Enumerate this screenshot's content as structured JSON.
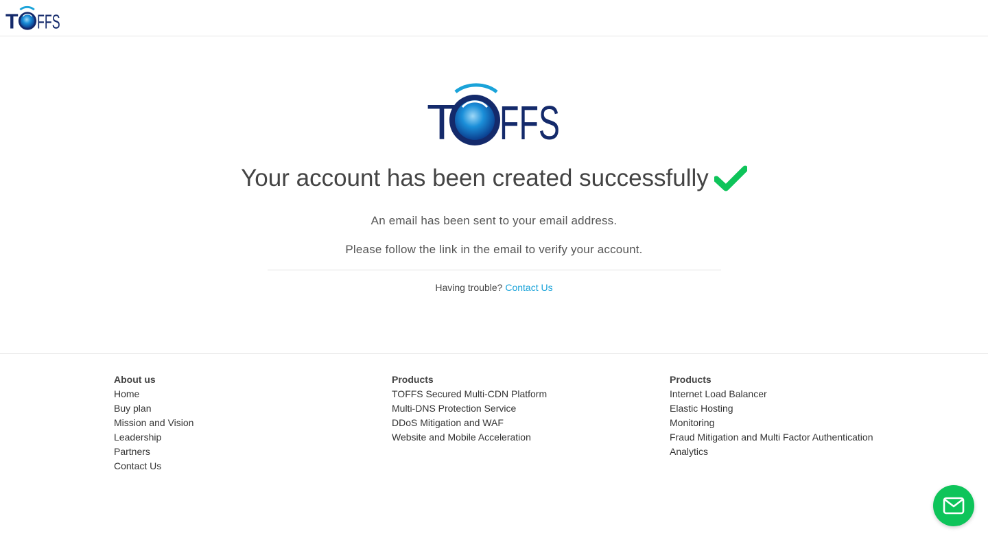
{
  "brand": {
    "logo_text": "TOFFS",
    "primary_color": "#142a6b",
    "accent_color": "#1aa3d9"
  },
  "main": {
    "title": "Your account has been created successfully",
    "message_line1": "An email has been sent to your email address.",
    "message_line2": "Please follow the link in the email to verify your account.",
    "trouble_text": "Having trouble? ",
    "contact_link": "Contact Us",
    "check_color": "#0ec45a"
  },
  "footer": {
    "col1": {
      "heading": "About us",
      "links": [
        "Home",
        "Buy plan",
        "Mission and Vision",
        "Leadership",
        "Partners",
        "Contact Us"
      ]
    },
    "col2": {
      "heading": "Products",
      "links": [
        "TOFFS Secured Multi-CDN Platform",
        "Multi-DNS Protection Service",
        "DDoS Mitigation and WAF",
        "Website and Mobile Acceleration"
      ]
    },
    "col3": {
      "heading": "Products",
      "links": [
        "Internet Load Balancer",
        "Elastic Hosting",
        "Monitoring",
        "Fraud Mitigation and Multi Factor Authentication",
        "Analytics"
      ]
    }
  },
  "chat": {
    "icon": "mail-icon",
    "color": "#0ec45a"
  }
}
